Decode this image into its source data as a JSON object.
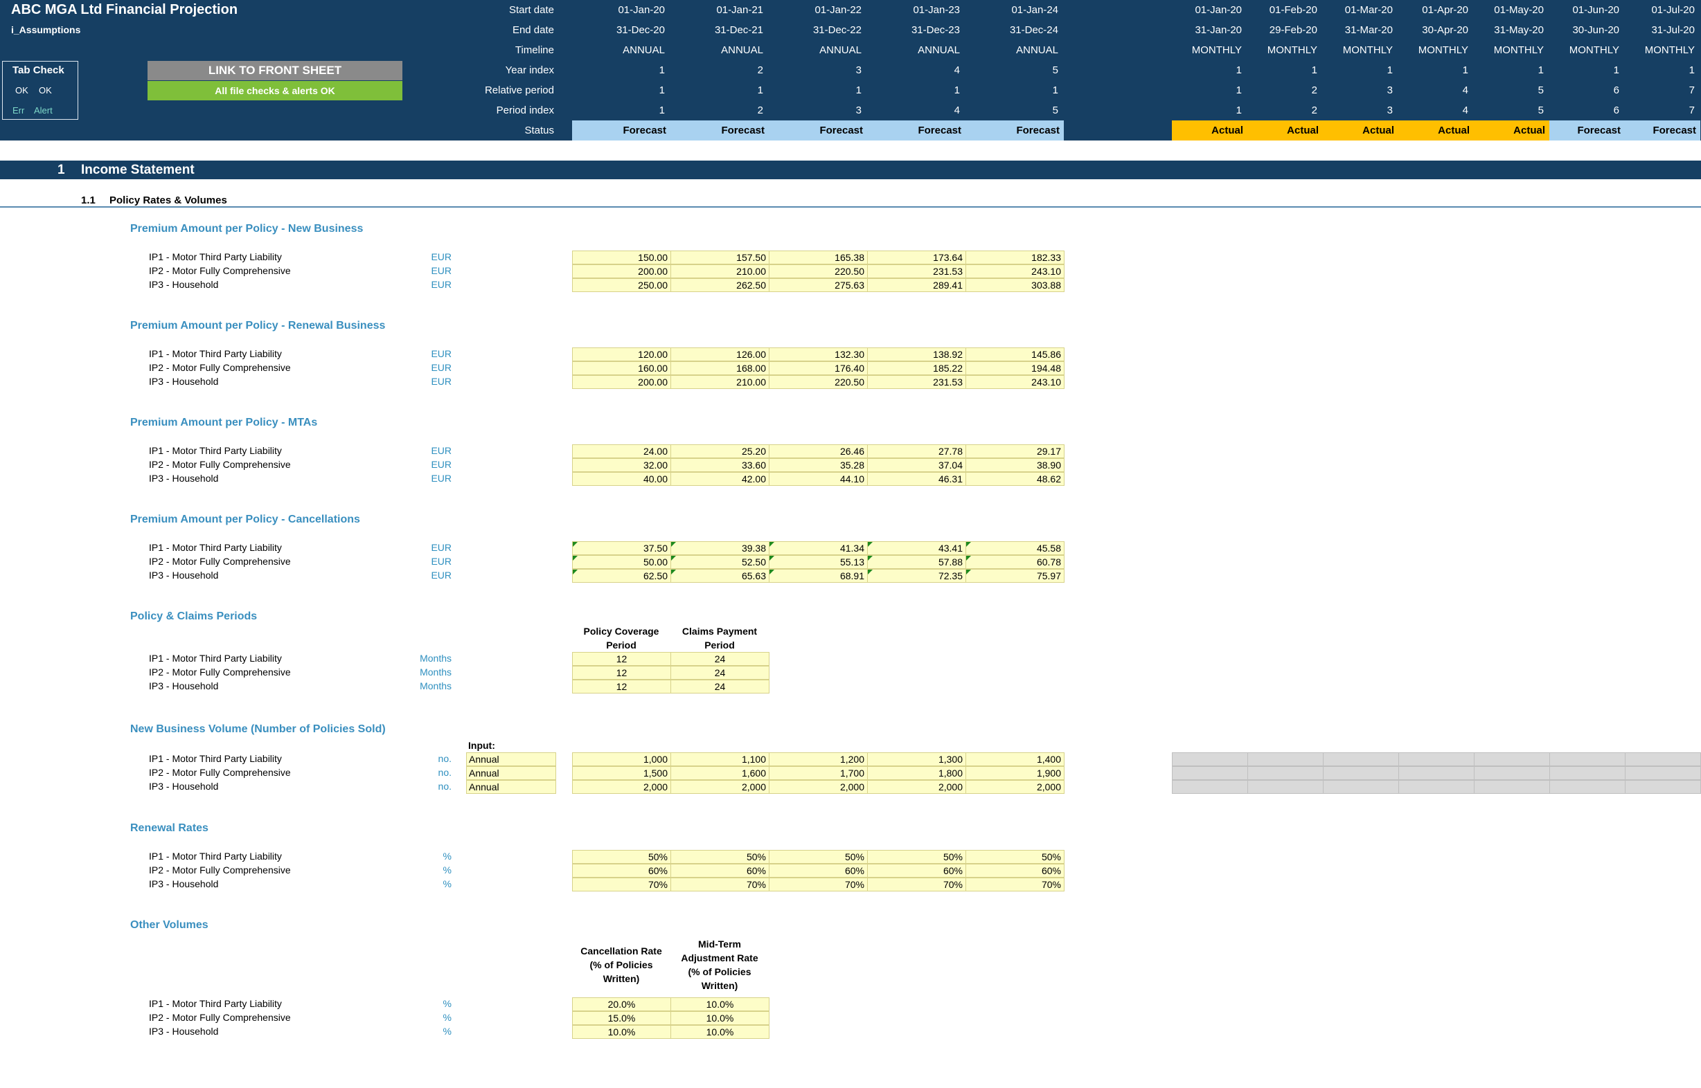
{
  "header": {
    "title": "ABC MGA Ltd Financial Projection",
    "sheet_name": "i_Assumptions",
    "tab_check": {
      "label": "Tab Check",
      "ok1": "OK",
      "ok2": "OK",
      "err": "Err",
      "alert": "Alert"
    },
    "link_button": "LINK TO FRONT SHEET",
    "checks_ok": "All file checks & alerts OK",
    "row_labels": [
      "Start date",
      "End date",
      "Timeline",
      "Year index",
      "Relative period",
      "Period index",
      "Status"
    ],
    "annual": {
      "start": [
        "01-Jan-20",
        "01-Jan-21",
        "01-Jan-22",
        "01-Jan-23",
        "01-Jan-24"
      ],
      "end": [
        "31-Dec-20",
        "31-Dec-21",
        "31-Dec-22",
        "31-Dec-23",
        "31-Dec-24"
      ],
      "timeline": [
        "ANNUAL",
        "ANNUAL",
        "ANNUAL",
        "ANNUAL",
        "ANNUAL"
      ],
      "year_index": [
        "1",
        "2",
        "3",
        "4",
        "5"
      ],
      "relative_period": [
        "1",
        "1",
        "1",
        "1",
        "1"
      ],
      "period_index": [
        "1",
        "2",
        "3",
        "4",
        "5"
      ],
      "status": [
        "Forecast",
        "Forecast",
        "Forecast",
        "Forecast",
        "Forecast"
      ]
    },
    "monthly": {
      "start": [
        "01-Jan-20",
        "01-Feb-20",
        "01-Mar-20",
        "01-Apr-20",
        "01-May-20",
        "01-Jun-20",
        "01-Jul-20"
      ],
      "end": [
        "31-Jan-20",
        "29-Feb-20",
        "31-Mar-20",
        "30-Apr-20",
        "31-May-20",
        "30-Jun-20",
        "31-Jul-20"
      ],
      "timeline": [
        "MONTHLY",
        "MONTHLY",
        "MONTHLY",
        "MONTHLY",
        "MONTHLY",
        "MONTHLY",
        "MONTHLY"
      ],
      "year_index": [
        "1",
        "1",
        "1",
        "1",
        "1",
        "1",
        "1"
      ],
      "relative_period": [
        "1",
        "2",
        "3",
        "4",
        "5",
        "6",
        "7"
      ],
      "period_index": [
        "1",
        "2",
        "3",
        "4",
        "5",
        "6",
        "7"
      ],
      "status": [
        "Actual",
        "Actual",
        "Actual",
        "Actual",
        "Actual",
        "Forecast",
        "Forecast"
      ]
    }
  },
  "section": {
    "number": "1",
    "title": "Income Statement"
  },
  "subsection": {
    "number": "1.1",
    "title": "Policy Rates & Volumes"
  },
  "products": [
    "IP1 - Motor Third Party Liability",
    "IP2 - Motor Fully Comprehensive",
    "IP3 - Household"
  ],
  "blocks": {
    "new_business": {
      "title": "Premium Amount per Policy - New Business",
      "unit": "EUR",
      "rows": [
        [
          "150.00",
          "157.50",
          "165.38",
          "173.64",
          "182.33"
        ],
        [
          "200.00",
          "210.00",
          "220.50",
          "231.53",
          "243.10"
        ],
        [
          "250.00",
          "262.50",
          "275.63",
          "289.41",
          "303.88"
        ]
      ]
    },
    "renewal": {
      "title": "Premium Amount per Policy - Renewal Business",
      "unit": "EUR",
      "rows": [
        [
          "120.00",
          "126.00",
          "132.30",
          "138.92",
          "145.86"
        ],
        [
          "160.00",
          "168.00",
          "176.40",
          "185.22",
          "194.48"
        ],
        [
          "200.00",
          "210.00",
          "220.50",
          "231.53",
          "243.10"
        ]
      ]
    },
    "mtas": {
      "title": "Premium Amount per Policy - MTAs",
      "unit": "EUR",
      "rows": [
        [
          "24.00",
          "25.20",
          "26.46",
          "27.78",
          "29.17"
        ],
        [
          "32.00",
          "33.60",
          "35.28",
          "37.04",
          "38.90"
        ],
        [
          "40.00",
          "42.00",
          "44.10",
          "46.31",
          "48.62"
        ]
      ]
    },
    "cancellations": {
      "title": "Premium Amount per Policy - Cancellations",
      "unit": "EUR",
      "rows": [
        [
          "37.50",
          "39.38",
          "41.34",
          "43.41",
          "45.58"
        ],
        [
          "50.00",
          "52.50",
          "55.13",
          "57.88",
          "60.78"
        ],
        [
          "62.50",
          "65.63",
          "68.91",
          "72.35",
          "75.97"
        ]
      ]
    },
    "periods": {
      "title": "Policy & Claims Periods",
      "unit": "Months",
      "col1_line1": "Policy Coverage",
      "col1_line2": "Period",
      "col2_line1": "Claims Payment",
      "col2_line2": "Period",
      "rows": [
        [
          "12",
          "24"
        ],
        [
          "12",
          "24"
        ],
        [
          "12",
          "24"
        ]
      ]
    },
    "nb_volume": {
      "title": "New Business Volume (Number of Policies Sold)",
      "unit": "no.",
      "input_label": "Input:",
      "inputs": [
        "Annual",
        "Annual",
        "Annual"
      ],
      "rows": [
        [
          "1,000",
          "1,100",
          "1,200",
          "1,300",
          "1,400"
        ],
        [
          "1,500",
          "1,600",
          "1,700",
          "1,800",
          "1,900"
        ],
        [
          "2,000",
          "2,000",
          "2,000",
          "2,000",
          "2,000"
        ]
      ]
    },
    "renewal_rates": {
      "title": "Renewal Rates",
      "unit": "%",
      "rows": [
        [
          "50%",
          "50%",
          "50%",
          "50%",
          "50%"
        ],
        [
          "60%",
          "60%",
          "60%",
          "60%",
          "60%"
        ],
        [
          "70%",
          "70%",
          "70%",
          "70%",
          "70%"
        ]
      ]
    },
    "other_volumes": {
      "title": "Other Volumes",
      "unit": "%",
      "col1": [
        "Cancellation Rate",
        "(% of Policies",
        "Written)"
      ],
      "col2": [
        "Mid-Term",
        "Adjustment Rate",
        "(% of Policies",
        "Written)"
      ],
      "rows": [
        [
          "20.0%",
          "10.0%"
        ],
        [
          "15.0%",
          "10.0%"
        ],
        [
          "10.0%",
          "10.0%"
        ]
      ]
    }
  }
}
